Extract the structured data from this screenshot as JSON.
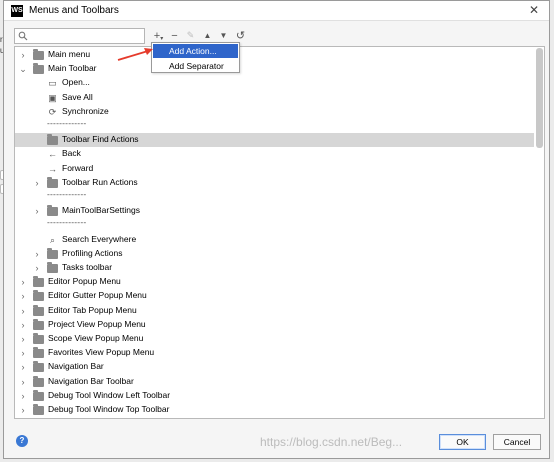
{
  "window": {
    "title": "Menus and Toolbars",
    "app_icon_text": "WS",
    "close_glyph": "✕"
  },
  "search": {
    "value": "",
    "placeholder": ""
  },
  "toolbar": {
    "add_glyph": "+",
    "add_dropdown_glyph": "▾",
    "remove_glyph": "−",
    "edit_glyph": "✎",
    "move_up_glyph": "▲",
    "move_down_glyph": "▼",
    "restore_glyph": "↺"
  },
  "tree": {
    "rows": [
      {
        "label": "Main menu",
        "level": 0,
        "expander": "›",
        "icon": "folder-icon"
      },
      {
        "label": "Main Toolbar",
        "level": 0,
        "expander": "⌄",
        "icon": "folder-icon"
      },
      {
        "label": "Open...",
        "level": 1,
        "expander": "",
        "icon": "open-icon"
      },
      {
        "label": "Save All",
        "level": 1,
        "expander": "",
        "icon": "save-icon"
      },
      {
        "label": "Synchronize",
        "level": 1,
        "expander": "",
        "icon": "sync-icon"
      },
      {
        "label": "-------------",
        "level": 1,
        "expander": "",
        "icon": "",
        "separator": true
      },
      {
        "label": "Toolbar Find Actions",
        "level": 1,
        "expander": "",
        "icon": "folder-icon",
        "selected": true
      },
      {
        "label": "Back",
        "level": 1,
        "expander": "",
        "icon": "back-icon"
      },
      {
        "label": "Forward",
        "level": 1,
        "expander": "",
        "icon": "forward-icon"
      },
      {
        "label": "Toolbar Run Actions",
        "level": 1,
        "expander": "›",
        "icon": "folder-icon"
      },
      {
        "label": "-------------",
        "level": 1,
        "expander": "",
        "icon": "",
        "separator": true
      },
      {
        "label": "MainToolBarSettings",
        "level": 1,
        "expander": "›",
        "icon": "folder-icon"
      },
      {
        "label": "-------------",
        "level": 1,
        "expander": "",
        "icon": "",
        "separator": true
      },
      {
        "label": "Search Everywhere",
        "level": 1,
        "expander": "",
        "icon": "search-icon"
      },
      {
        "label": "Profiling Actions",
        "level": 1,
        "expander": "›",
        "icon": "folder-icon"
      },
      {
        "label": "Tasks toolbar",
        "level": 1,
        "expander": "›",
        "icon": "folder-icon"
      },
      {
        "label": "Editor Popup Menu",
        "level": 0,
        "expander": "›",
        "icon": "folder-icon"
      },
      {
        "label": "Editor Gutter Popup Menu",
        "level": 0,
        "expander": "›",
        "icon": "folder-icon"
      },
      {
        "label": "Editor Tab Popup Menu",
        "level": 0,
        "expander": "›",
        "icon": "folder-icon"
      },
      {
        "label": "Project View Popup Menu",
        "level": 0,
        "expander": "›",
        "icon": "folder-icon"
      },
      {
        "label": "Scope View Popup Menu",
        "level": 0,
        "expander": "›",
        "icon": "folder-icon"
      },
      {
        "label": "Favorites View Popup Menu",
        "level": 0,
        "expander": "›",
        "icon": "folder-icon"
      },
      {
        "label": "Navigation Bar",
        "level": 0,
        "expander": "›",
        "icon": "folder-icon"
      },
      {
        "label": "Navigation Bar Toolbar",
        "level": 0,
        "expander": "›",
        "icon": "folder-icon"
      },
      {
        "label": "Debug Tool Window Left Toolbar",
        "level": 0,
        "expander": "›",
        "icon": "folder-icon"
      },
      {
        "label": "Debug Tool Window Top Toolbar",
        "level": 0,
        "expander": "›",
        "icon": "folder-icon"
      }
    ]
  },
  "popup": {
    "items": [
      {
        "label": "Add Action...",
        "highlighted": true
      },
      {
        "label": "Add Separator",
        "highlighted": false
      }
    ]
  },
  "footer": {
    "help_glyph": "?",
    "ok_label": "OK",
    "cancel_label": "Cancel"
  },
  "watermark": "https://blog.csdn.net/Beg...",
  "colors": {
    "selection": "#d6d6d6",
    "popup_highlight": "#2f65ca",
    "arrow": "#e53b2c",
    "help": "#3a78d4"
  }
}
